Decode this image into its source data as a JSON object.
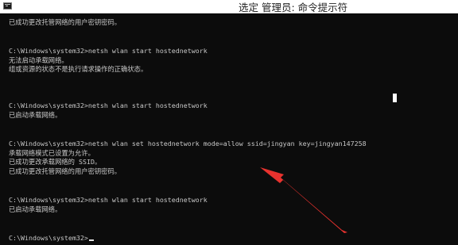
{
  "window": {
    "title": "选定 管理员: 命令提示符",
    "icon": "cmd-icon"
  },
  "console": {
    "lines": [
      "已成功更改托管网络的用户密钥密码。",
      "C:\\Windows\\system32>netsh wlan start hostednetwork",
      "无法启动承载网络。",
      "组或资源的状态不是执行请求操作的正确状态。",
      "C:\\Windows\\system32>netsh wlan start hostednetwork",
      "已启动承载网络。",
      "C:\\Windows\\system32>netsh wlan set hostednetwork mode=allow ssid=jingyan key=jingyan147258",
      "承载网络模式已设置为允许。",
      "已成功更改承载网络的 SSID。",
      "已成功更改托管网络的用户密钥密码。",
      "C:\\Windows\\system32>netsh wlan start hostednetwork",
      "已启动承载网络。",
      "C:\\Windows\\system32>"
    ]
  },
  "annotation": {
    "icon": "red-arrow-icon",
    "color": "#e8322e"
  }
}
